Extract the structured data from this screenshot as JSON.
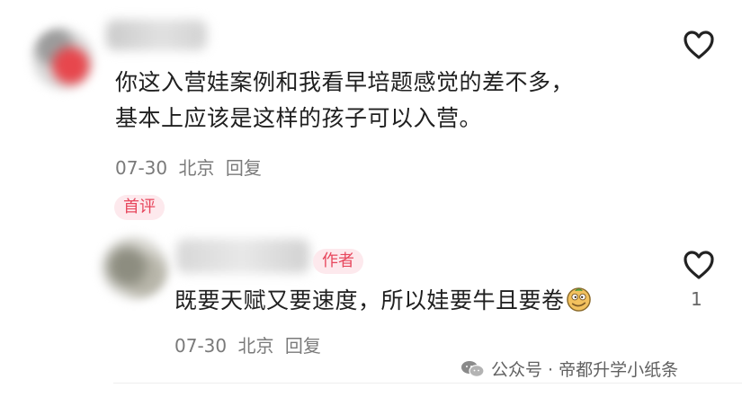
{
  "comments": [
    {
      "text_lines": [
        "你这入营娃案例和我看早培题感觉的差不多，",
        "基本上应该是这样的孩子可以入营。"
      ],
      "date": "07-30",
      "location": "北京",
      "reply_label": "回复",
      "badge": "首评"
    },
    {
      "text": "既要天赋又要速度，所以娃要牛且要卷",
      "date": "07-30",
      "location": "北京",
      "reply_label": "回复",
      "author_badge": "作者",
      "like_count": "1",
      "emoji_icon": "smirk-face-emoji"
    }
  ],
  "watermark": {
    "text": "公众号 · 帝都升学小纸条",
    "icon": "wechat-icon"
  },
  "colors": {
    "badge_text": "#e7475d",
    "badge_bg": "#fde9ed",
    "meta_text": "#7a7a7a",
    "heart_stroke": "#222222"
  }
}
